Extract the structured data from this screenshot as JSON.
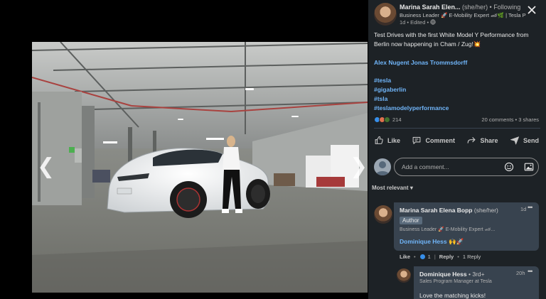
{
  "post": {
    "author_name": "Marina Sarah Elen...",
    "author_pronouns": "(she/her) • Following",
    "author_headline": "Business Leader 🚀 E-Mobility Expert 🏎🌿 | Tesla P",
    "time": "1d • Edited •",
    "text": "Test Drives with the first White Model Y Performance from Berlin now happening in Cham / Zug!💥",
    "mentions": "Alex Nugent Jonas Trommsdorff",
    "hashtags": [
      "#tesla",
      "#gigaberlin",
      "#tsla",
      "#teslamodelyperformance"
    ],
    "reaction_count": "214",
    "counts": "20 comments • 3 shares"
  },
  "actions": {
    "like": "Like",
    "comment": "Comment",
    "share": "Share",
    "send": "Send"
  },
  "composer": {
    "placeholder": "Add a comment..."
  },
  "sort_label": "Most relevant",
  "comments": [
    {
      "name": "Marina Sarah Elena Bopp",
      "pronouns": "(she/her)",
      "badge": "Author",
      "headline": "Business Leader 🚀 E-Mobility Expert 🏎...",
      "time": "1d",
      "text": "Dominique Hess 🙌🚀",
      "like": "Like",
      "reaction_count": "1",
      "reply": "Reply",
      "reply_count": "1 Reply"
    },
    {
      "name": "Dominique Hess",
      "degree": "• 3rd+",
      "headline": "Sales Program Manager at Tesla",
      "time": "20h",
      "text": "Love the matching kicks!"
    }
  ],
  "colors": {
    "background": "#1d2226",
    "link": "#70b5f9",
    "bubble": "#38434f"
  }
}
